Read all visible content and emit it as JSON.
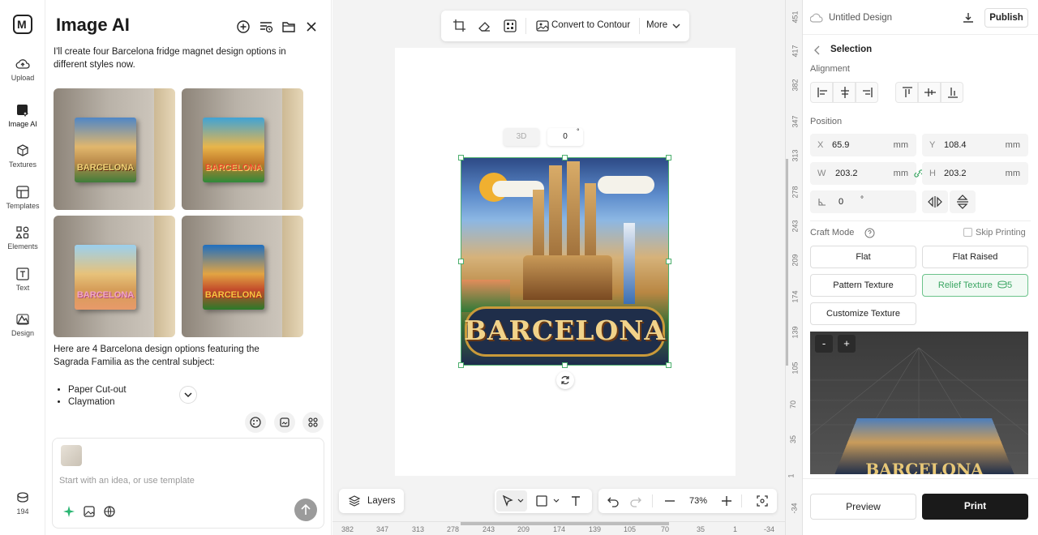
{
  "rail": {
    "logo": "M",
    "items": [
      {
        "label": "Upload",
        "icon": "upload-cloud-icon"
      },
      {
        "label": "Image AI",
        "icon": "image-ai-icon"
      },
      {
        "label": "Textures",
        "icon": "textures-icon"
      },
      {
        "label": "Templates",
        "icon": "templates-icon"
      },
      {
        "label": "Elements",
        "icon": "elements-icon"
      },
      {
        "label": "Text",
        "icon": "text-icon"
      },
      {
        "label": "Design",
        "icon": "design-icon"
      }
    ],
    "credits": "194"
  },
  "chat": {
    "title": "Image AI",
    "intro": "I'll create four Barcelona fridge magnet design options in different styles now.",
    "thumb_word": "BARCELONA",
    "summary": "Here are 4 Barcelona design options featuring the Sagrada Familia as the central subject:",
    "bullets": [
      "Paper Cut-out",
      "Claymation"
    ],
    "placeholder": "Start with an idea, or use template"
  },
  "toolbar": {
    "convert_label": "Convert to Contour",
    "more_label": "More"
  },
  "canvas": {
    "mode_chip": "3D",
    "rotation_value": "0",
    "rotation_unit": "°",
    "design_word": "BARCELONA",
    "layers_label": "Layers",
    "zoom": "73%",
    "h_ruler": [
      "382",
      "347",
      "313",
      "278",
      "243",
      "209",
      "174",
      "139",
      "105",
      "70",
      "35",
      "1",
      "-34"
    ],
    "v_ruler": [
      "451",
      "417",
      "382",
      "347",
      "313",
      "278",
      "243",
      "209",
      "174",
      "139",
      "105",
      "70",
      "35",
      "1",
      "-34"
    ]
  },
  "props": {
    "doc_title": "Untitled Design",
    "publish_label": "Publish",
    "back_label": "Selection",
    "alignment_label": "Alignment",
    "position_label": "Position",
    "x": {
      "key": "X",
      "value": "65.9",
      "unit": "mm"
    },
    "y": {
      "key": "Y",
      "value": "108.4",
      "unit": "mm"
    },
    "w": {
      "key": "W",
      "value": "203.2",
      "unit": "mm"
    },
    "h": {
      "key": "H",
      "value": "203.2",
      "unit": "mm"
    },
    "angle": {
      "value": "0",
      "unit": "°"
    },
    "craft_label": "Craft Mode",
    "skip_label": "Skip Printing",
    "modes": {
      "flat": "Flat",
      "flat_raised": "Flat Raised",
      "pattern": "Pattern Texture",
      "relief": "Relief Texture",
      "relief_count": "5",
      "customize": "Customize Texture"
    },
    "preview_word": "BARCELONA",
    "minus": "-",
    "plus": "+",
    "preview_label": "Preview",
    "print_label": "Print"
  },
  "colors": {
    "accent": "#3aa562",
    "selection": "#4caf6d",
    "dark": "#1a1a1a"
  }
}
